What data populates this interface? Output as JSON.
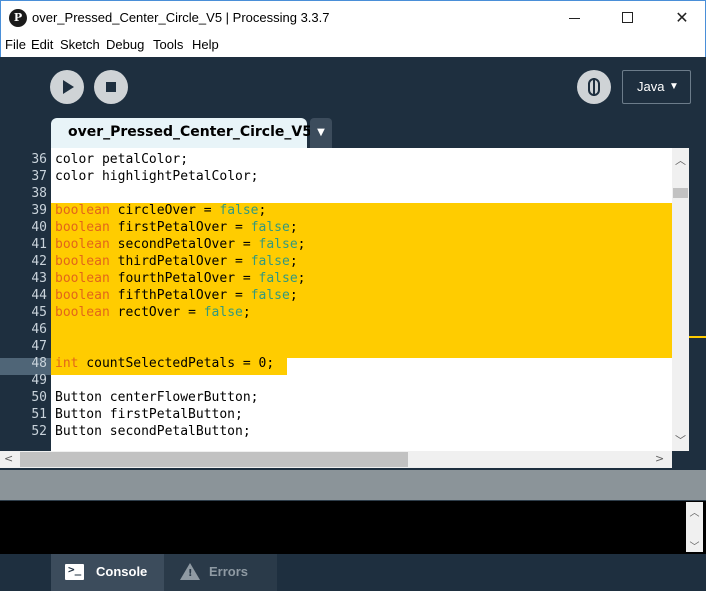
{
  "window": {
    "title": "over_Pressed_Center_Circle_V5 | Processing 3.3.7",
    "logo_glyph": "P",
    "minimize_glyph": "",
    "close_glyph": "✕"
  },
  "menu": {
    "items": [
      "File",
      "Edit",
      "Sketch",
      "Debug",
      "Tools",
      "Help"
    ]
  },
  "toolbar": {
    "mode_label": "Java",
    "mode_arrow": "▼",
    "icons": [
      "play-icon",
      "stop-icon",
      "debugger-icon"
    ]
  },
  "tabs": {
    "active_label": "over_Pressed_Center_Circle_V5",
    "menu_arrow": "▼"
  },
  "editor": {
    "lines": [
      {
        "n": "36",
        "parts": [
          {
            "t": "color",
            "c": "plain"
          },
          {
            "t": " petalColor;",
            "c": "plain"
          }
        ]
      },
      {
        "n": "37",
        "parts": [
          {
            "t": "color",
            "c": "plain"
          },
          {
            "t": " highlightPetalColor;",
            "c": "plain"
          }
        ]
      },
      {
        "n": "38",
        "parts": []
      },
      {
        "n": "39",
        "parts": [
          {
            "t": "boolean",
            "c": "kw-type"
          },
          {
            "t": " circleOver = ",
            "c": "plain"
          },
          {
            "t": "false",
            "c": "kw-lit"
          },
          {
            "t": ";",
            "c": "plain"
          }
        ]
      },
      {
        "n": "40",
        "parts": [
          {
            "t": "boolean",
            "c": "kw-type"
          },
          {
            "t": " firstPetalOver = ",
            "c": "plain"
          },
          {
            "t": "false",
            "c": "kw-lit"
          },
          {
            "t": ";",
            "c": "plain"
          }
        ]
      },
      {
        "n": "41",
        "parts": [
          {
            "t": "boolean",
            "c": "kw-type"
          },
          {
            "t": " secondPetalOver = ",
            "c": "plain"
          },
          {
            "t": "false",
            "c": "kw-lit"
          },
          {
            "t": ";",
            "c": "plain"
          }
        ]
      },
      {
        "n": "42",
        "parts": [
          {
            "t": "boolean",
            "c": "kw-type"
          },
          {
            "t": " thirdPetalOver = ",
            "c": "plain"
          },
          {
            "t": "false",
            "c": "kw-lit"
          },
          {
            "t": ";",
            "c": "plain"
          }
        ]
      },
      {
        "n": "43",
        "parts": [
          {
            "t": "boolean",
            "c": "kw-type"
          },
          {
            "t": " fourthPetalOver = ",
            "c": "plain"
          },
          {
            "t": "false",
            "c": "kw-lit"
          },
          {
            "t": ";",
            "c": "plain"
          }
        ]
      },
      {
        "n": "44",
        "parts": [
          {
            "t": "boolean",
            "c": "kw-type"
          },
          {
            "t": " fifthPetalOver = ",
            "c": "plain"
          },
          {
            "t": "false",
            "c": "kw-lit"
          },
          {
            "t": ";",
            "c": "plain"
          }
        ]
      },
      {
        "n": "45",
        "parts": [
          {
            "t": "boolean",
            "c": "kw-type"
          },
          {
            "t": " rectOver = ",
            "c": "plain"
          },
          {
            "t": "false",
            "c": "kw-lit"
          },
          {
            "t": ";",
            "c": "plain"
          }
        ]
      },
      {
        "n": "46",
        "parts": []
      },
      {
        "n": "47",
        "parts": []
      },
      {
        "n": "48",
        "parts": [
          {
            "t": "int",
            "c": "kw-type"
          },
          {
            "t": " countSelectedPetals = 0;",
            "c": "plain"
          }
        ]
      },
      {
        "n": "49",
        "parts": []
      },
      {
        "n": "50",
        "parts": [
          {
            "t": "Button centerFlowerButton;",
            "c": "plain"
          }
        ]
      },
      {
        "n": "51",
        "parts": [
          {
            "t": "Button firstPetalButton;",
            "c": "plain"
          }
        ]
      },
      {
        "n": "52",
        "parts": [
          {
            "t": "Button secondPetalButton;",
            "c": "plain"
          }
        ]
      }
    ],
    "colors": {
      "type_keyword": "#e2661a",
      "literal": "#33997e",
      "selection": "#ffcc00",
      "chrome": "#1e2f3f"
    }
  },
  "scroll": {
    "up_glyph": "︿",
    "down_glyph": "﹀",
    "left_glyph": "<",
    "right_glyph": ">"
  },
  "footer": {
    "console_label": "Console",
    "errors_label": "Errors",
    "console_glyph": ">_",
    "warn_glyph": "!"
  }
}
